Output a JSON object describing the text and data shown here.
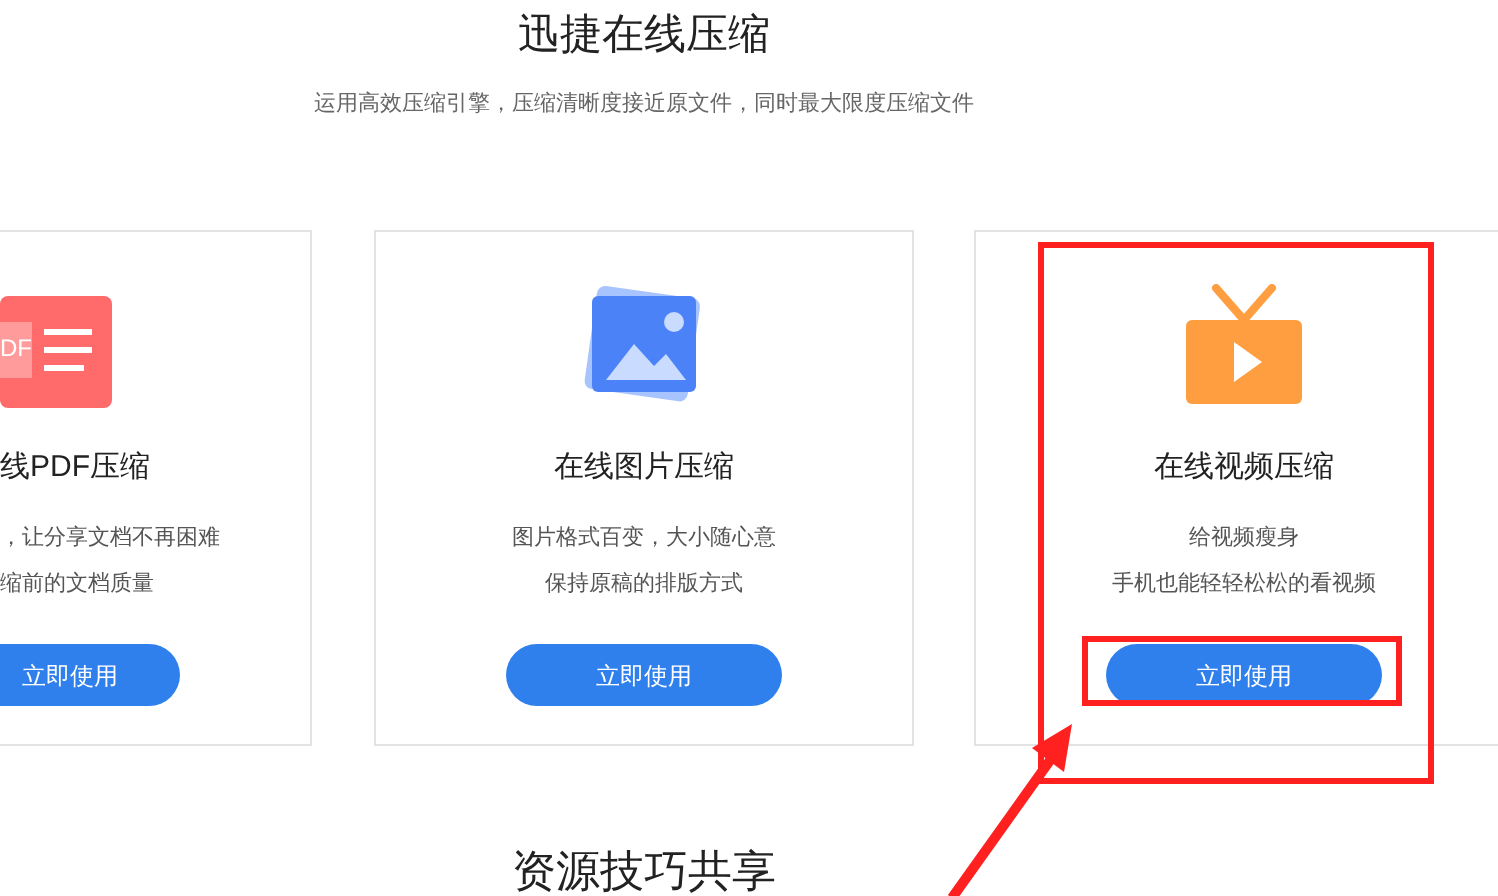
{
  "header": {
    "title": "迅捷在线压缩",
    "subtitle": "运用高效压缩引擎，压缩清晰度接近原文件，同时最大限度压缩文件"
  },
  "cards": [
    {
      "kind": "pdf",
      "icon_label": "DF",
      "title": "线PDF压缩",
      "lines": [
        "，让分享文档不再困难",
        "缩前的文档质量"
      ],
      "button": "立即使用",
      "cut": true,
      "highlighted": false
    },
    {
      "kind": "image",
      "title": "在线图片压缩",
      "lines": [
        "图片格式百变，大小随心意",
        "保持原稿的排版方式"
      ],
      "button": "立即使用",
      "cut": false,
      "highlighted": false
    },
    {
      "kind": "video",
      "title": "在线视频压缩",
      "lines": [
        "给视频瘦身",
        "手机也能轻轻松松的看视频"
      ],
      "button": "立即使用",
      "cut": false,
      "highlighted": true
    }
  ],
  "section_heading": "资源技巧共享"
}
